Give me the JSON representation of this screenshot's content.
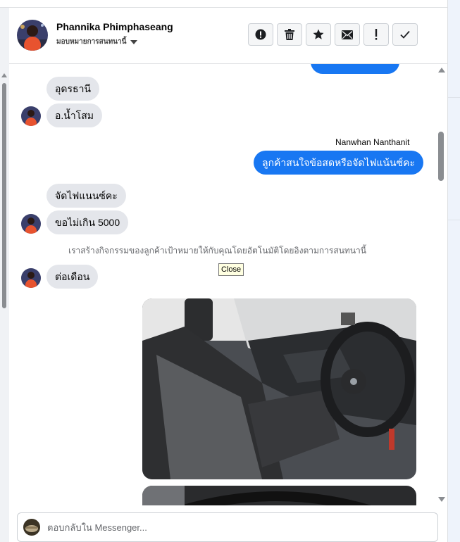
{
  "header": {
    "contact_name": "Phannika Phimphaseang",
    "status_label": "มอบหมายการสนทนานี้"
  },
  "actions": [
    {
      "name": "report-spam-button",
      "icon": "exclamation-circle-icon"
    },
    {
      "name": "delete-button",
      "icon": "trash-icon"
    },
    {
      "name": "star-button",
      "icon": "star-icon"
    },
    {
      "name": "mark-unread-button",
      "icon": "envelope-icon"
    },
    {
      "name": "follow-up-button",
      "icon": "exclamation-icon"
    },
    {
      "name": "mark-done-button",
      "icon": "checkmark-icon"
    }
  ],
  "messages": {
    "m1": "อุดรธานี",
    "m2": "อ.น้ำโสม",
    "sender_page": "Nanwhan Nanthanit",
    "m3": "ลูกค้าสนใจข้อสดหรือจัดไฟแน้นซ์คะ",
    "m4": "จัดไฟแนนซ์คะ",
    "m5": "ขอไม่เกิน 5000",
    "system": "เราสร้างกิจกรรมของลูกค้าเป้าหมายให้กับคุณโดยอัตโนมัติโดยอิงตามการสนทนานี้",
    "m6": "ต่อเดือน"
  },
  "tooltip": "Close",
  "composer": {
    "placeholder": "ตอบกลับใน Messenger..."
  },
  "colors": {
    "outgoing_bubble": "#1877f2",
    "incoming_bubble": "#e4e6eb"
  }
}
